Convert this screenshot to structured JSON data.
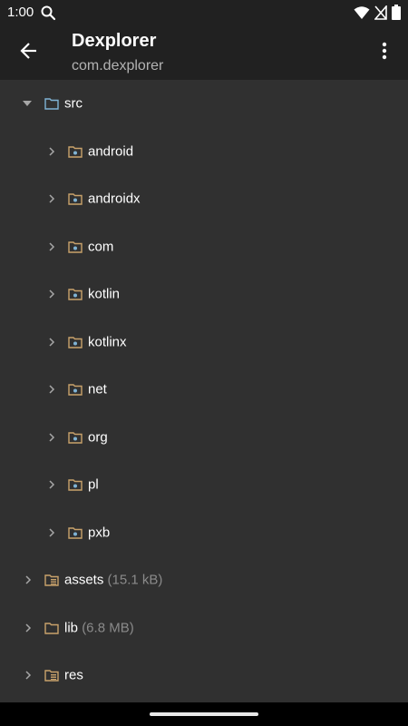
{
  "status_bar": {
    "time": "1:00",
    "icons": [
      "search-icon",
      "wifi-icon",
      "no-sim-icon",
      "battery-icon"
    ]
  },
  "app_bar": {
    "title": "Dexplorer",
    "subtitle": "com.dexplorer",
    "back_icon": "arrow-back-icon",
    "menu_icon": "more-vert-icon"
  },
  "colors": {
    "background": "#303030",
    "app_bar": "#212121",
    "folder_src": "#7fb3d5",
    "folder_package": "#c9a26b",
    "folder_res": "#c9a26b",
    "size_text": "#8a8a8a"
  },
  "tree": {
    "root": {
      "name": "src",
      "expanded": true,
      "icon": "source-folder-icon"
    },
    "packages": [
      {
        "name": "android"
      },
      {
        "name": "androidx"
      },
      {
        "name": "com"
      },
      {
        "name": "kotlin"
      },
      {
        "name": "kotlinx"
      },
      {
        "name": "net"
      },
      {
        "name": "org"
      },
      {
        "name": "pl"
      },
      {
        "name": "pxb"
      }
    ],
    "folders": [
      {
        "name": "assets",
        "size": "(15.1 kB)",
        "icon": "resource-folder-icon"
      },
      {
        "name": "lib",
        "size": "(6.8 MB)",
        "icon": "folder-icon"
      },
      {
        "name": "res",
        "size": "",
        "icon": "resource-folder-icon"
      }
    ]
  }
}
